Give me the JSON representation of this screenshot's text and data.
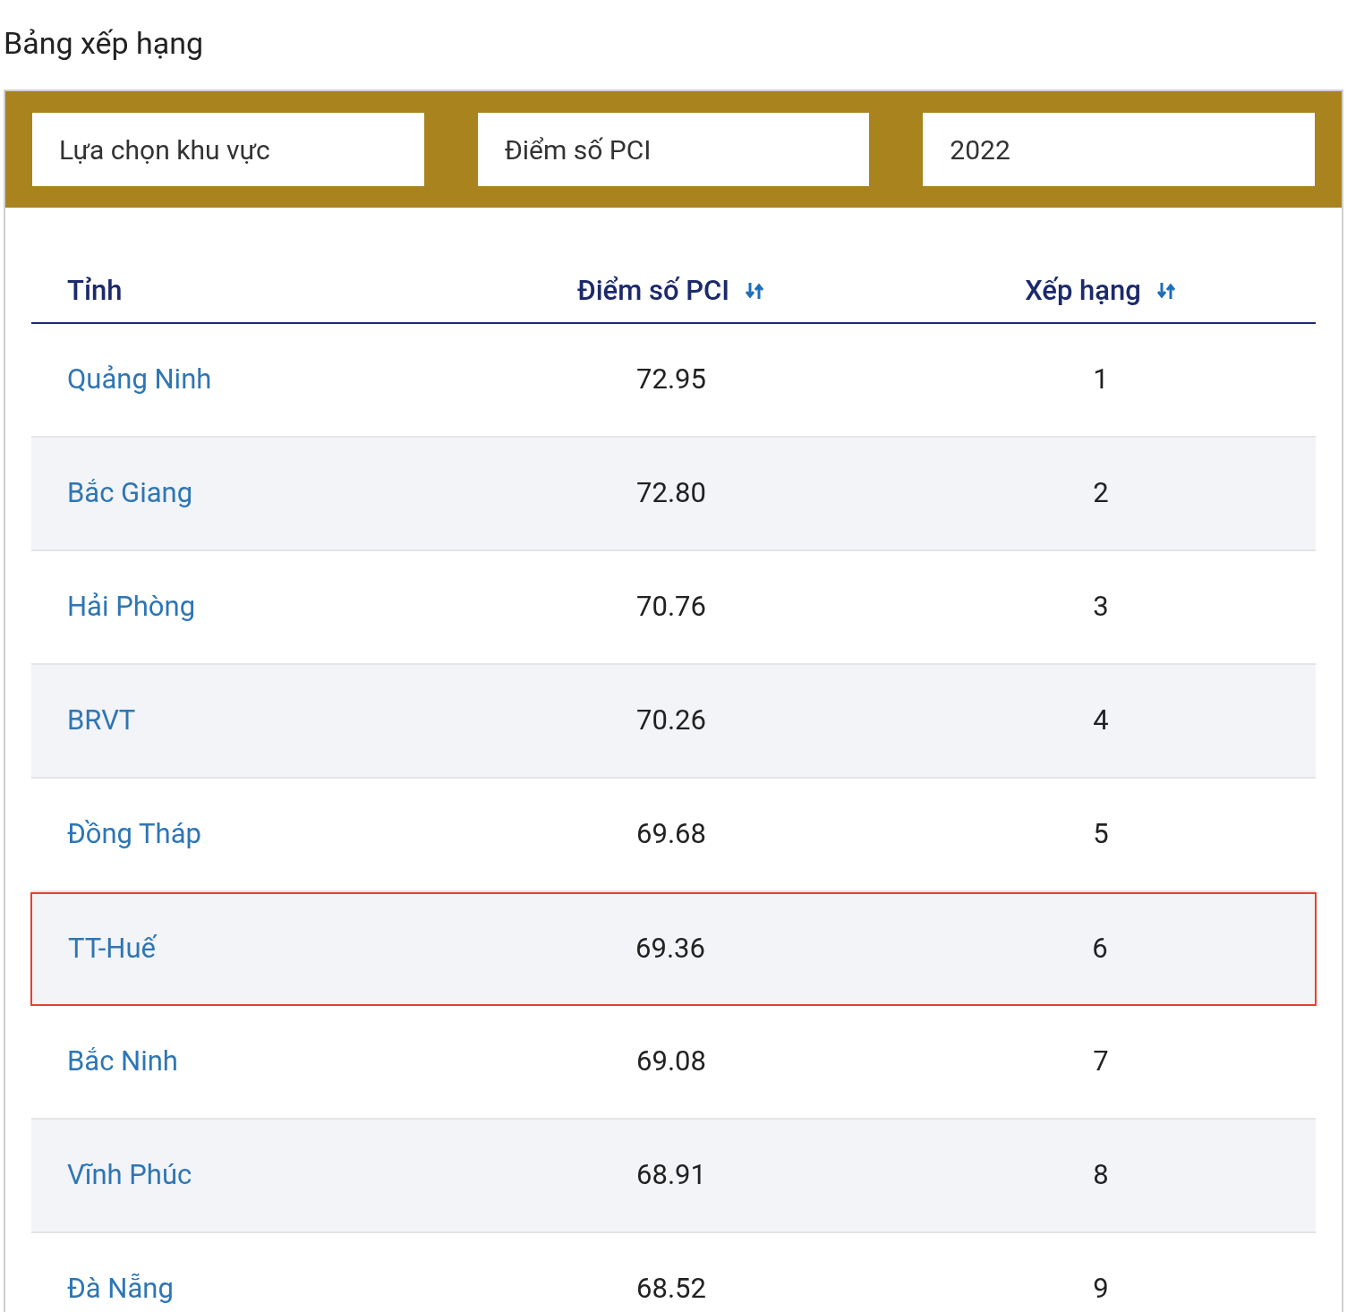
{
  "title": "Bảng xếp hạng",
  "filters": [
    {
      "value": "Lựa chọn khu vực"
    },
    {
      "value": "Điểm số PCI"
    },
    {
      "value": "2022"
    }
  ],
  "table": {
    "columns": [
      {
        "label": "Tỉnh",
        "sortable": false
      },
      {
        "label": "Điểm số PCI",
        "sortable": true
      },
      {
        "label": "Xếp hạng",
        "sortable": true
      }
    ],
    "rows": [
      {
        "province": "Quảng Ninh",
        "score": "72.95",
        "rank": "1",
        "highlighted": false
      },
      {
        "province": "Bắc Giang",
        "score": "72.80",
        "rank": "2",
        "highlighted": false
      },
      {
        "province": "Hải Phòng",
        "score": "70.76",
        "rank": "3",
        "highlighted": false
      },
      {
        "province": "BRVT",
        "score": "70.26",
        "rank": "4",
        "highlighted": false
      },
      {
        "province": "Đồng Tháp",
        "score": "69.68",
        "rank": "5",
        "highlighted": false
      },
      {
        "province": "TT-Huế",
        "score": "69.36",
        "rank": "6",
        "highlighted": true
      },
      {
        "province": "Bắc Ninh",
        "score": "69.08",
        "rank": "7",
        "highlighted": false
      },
      {
        "province": "Vĩnh Phúc",
        "score": "68.91",
        "rank": "8",
        "highlighted": false
      },
      {
        "province": "Đà Nẵng",
        "score": "68.52",
        "rank": "9",
        "highlighted": false
      }
    ]
  }
}
